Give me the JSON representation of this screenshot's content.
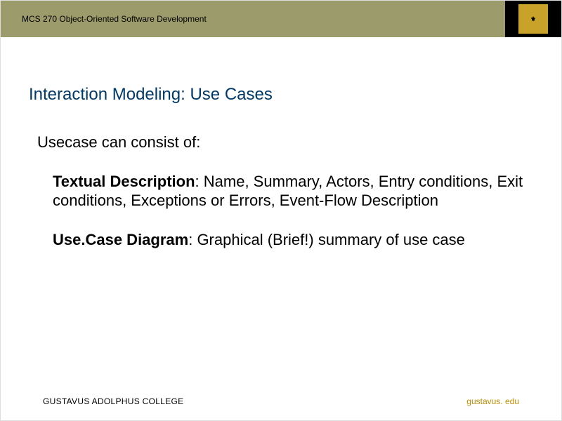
{
  "header": {
    "course_label": "MCS 270 Object-Oriented Software Development"
  },
  "title": "Interaction Modeling: Use Cases",
  "intro": "Usecase can consist of:",
  "items": [
    {
      "term": "Textual Description",
      "rest": ": Name, Summary, Actors, Entry conditions, Exit conditions, Exceptions or Errors, Event-Flow Description"
    },
    {
      "term": "Use.Case Diagram",
      "rest": ": Graphical (Brief!) summary of use case"
    }
  ],
  "footer": {
    "left": "GUSTAVUS ADOLPHUS COLLEGE",
    "right": "gustavus. edu"
  },
  "logo_text": "⚜"
}
